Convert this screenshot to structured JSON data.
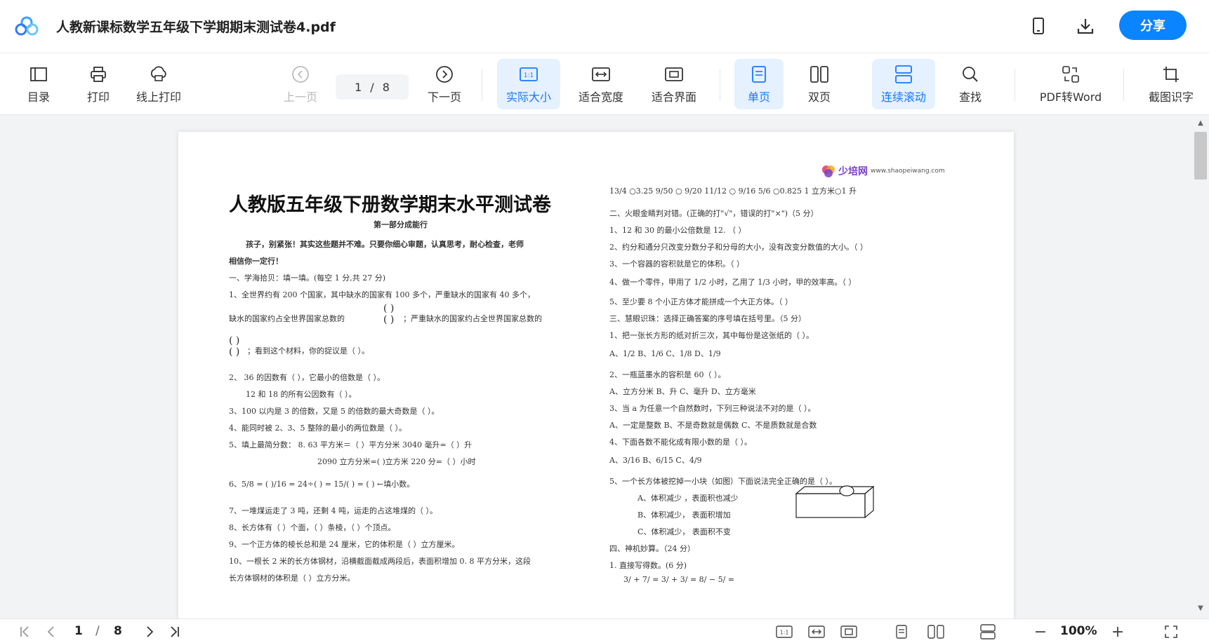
{
  "titlebar": {
    "doc_title": "人教新课标数学五年级下学期期末测试卷4.pdf",
    "share_label": "分享"
  },
  "toolbar": {
    "items": [
      {
        "label": "目录",
        "icon": "sidebar-icon"
      },
      {
        "label": "打印",
        "icon": "printer-icon"
      },
      {
        "label": "线上打印",
        "icon": "cloud-print-icon"
      },
      {
        "label": "上一页",
        "icon": "prev-page-icon"
      },
      {
        "label": "下一页",
        "icon": "next-page-icon"
      },
      {
        "label": "实际大小",
        "icon": "actual-size-icon"
      },
      {
        "label": "适合宽度",
        "icon": "fit-width-icon"
      },
      {
        "label": "适合界面",
        "icon": "fit-page-icon"
      },
      {
        "label": "单页",
        "icon": "single-page-icon"
      },
      {
        "label": "双页",
        "icon": "double-page-icon"
      },
      {
        "label": "连续滚动",
        "icon": "continuous-scroll-icon"
      },
      {
        "label": "查找",
        "icon": "search-icon"
      },
      {
        "label": "PDF转Word",
        "icon": "pdf-to-word-icon"
      },
      {
        "label": "截图识字",
        "icon": "screenshot-ocr-icon"
      }
    ],
    "page_current": "1",
    "page_sep": "/",
    "page_total": "8"
  },
  "pdf": {
    "title": "人教版五年级下册数学期末水平测试卷",
    "site_name": "少培网",
    "site_url": "www.shaopeiwang.com",
    "left_lines": [
      "第一部分成能行",
      "孩子，别紧张！其实这些题并不难。只要你细心审题，认真思考，耐心检查，老师",
      "相信你一定行！",
      "一、学海拾贝：填一填。(每空 1 分,共 27 分)",
      "1、全世界约有 200 个国家，其中缺水的国家有 100 多个，严重缺水的国家有 40 多个，",
      "缺水的国家约占全世界国家总数的",
      "；严重缺水的国家约占全世界国家总数的",
      "；看到这个材料，你的捉议是（                              ）。",
      "2、 36 的因数有（                                         ），它最小的倍数是（       ）。",
      "12 和 18 的所有公因数有（                                 ）。",
      "3、100 以内是 3 的倍数，又是 5 的倍数的最大奇数是（      ）。",
      "4、能同时被 2、3、5 整除的最小的两位数是（        ）。",
      "5、填上最简分数：      8. 63 平方米＝（         ）平方分米      3040 毫升=（     ）升",
      "2090 立方分米=(             )立方米          220 分=（        ）小时",
      "6、5/8 = (   )/16 = 24÷(        ) = 15/(     ) = (          ) ←填小数。",
      "7、一堆煤运走了 3 吨，还剩 4 吨，运走的占这堆煤的（           ）。",
      "8、长方体有（    ）个面，（    ）条棱，（    ）个顶点。",
      "9、一个正方体的棱长总和是 24 厘米，它的体积是（         ）立方厘米。",
      "10、一根长 2 米的长方体钢材，沿横截面截成两段后，表面积增加 0. 8 平方分米，这段",
      "长方体钢材的体积是（     ）立方分米。"
    ],
    "right_lines": [
      "13/4 ○3.25      9/50 ○ 9/20          11/12 ○ 9/16      5/6 ○0.825        1 立方米○1 升",
      "二、火眼金睛判对错。(正确的打\"√\"，错误的打\"×\")（5 分）",
      "1、12 和 30 的最小公倍数是 12.     （     ）",
      "2、约分和通分只改变分数分子和分母的大小，没有改变分数值的大小。（    ）",
      "3、一个容器的容积就是它的体积。（      ）",
      "4、做一个零件，甲用了 1/2 小时，乙用了 1/3 小时，甲的效率高。（      ）",
      "5、至少要 8 个小正方体才能拼成一个大正方体。（        ）",
      "三、慧眼识珠：选择正确答案的序号填在括号里。（5 分）",
      "1、把一张长方形的纸对折三次，其中每份是这张纸的（     ）。",
      "A、1/2        B、1/6        C、1/8        D、1/9",
      "2、一瓶蓝墨水的容积是 60（        ）。",
      "A、立方分米       B、升       C、毫升       D、立方毫米",
      "3、当 a 为任意一个自然数时，下列三种说法不对的是（       ）。",
      "A、一定是整数          B、不是奇数就是偶数     C、不是质数就是合数",
      "4、下面各数不能化成有限小数的是（      ）。",
      "A、3/16          B、6/15          C、4/9",
      "5、一个长方体被挖掉一小块（如图）下面说法完全正确的是（        ）。",
      "A、体积减少 ，表面积也减少",
      "B、体积减少，  表面积增加",
      "C、体积减少，  表面积不变",
      "四、神机妙算。（24 分）",
      "1. 直接写得数。(6 分)",
      "3/  +  7/  =           3/  +  3/  =               8/  −  5/  ="
    ]
  },
  "statusbar": {
    "page_current": "1",
    "page_sep": "/",
    "page_total": "8",
    "zoom": "100%"
  },
  "colors": {
    "accent": "#0a84ff",
    "active_bg": "#e5f1ff",
    "active_text": "#1677ff"
  }
}
